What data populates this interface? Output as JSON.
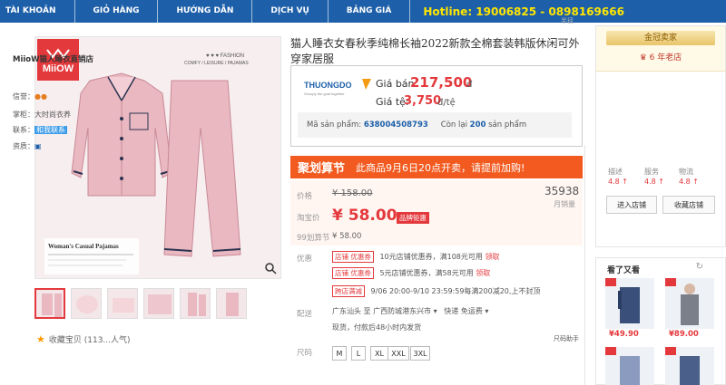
{
  "nav": {
    "items": [
      "TÀI KHOẢN",
      "GIỎ HÀNG",
      "HƯỚNG DẪN",
      "DỊCH VỤ",
      "BẢNG GIÁ"
    ],
    "hotline": "Hotline: 19006825 - 0898169666"
  },
  "gallery": {
    "brand_logo": "MiiOW",
    "fashion_text": "♥ ♥ ♥  FASHION",
    "fashion_sub": "COMFY / LEISURE / PAJAMAS",
    "caption": "Woman's Casual Pajamas",
    "thumb_count": 6
  },
  "favorite": {
    "label": "收藏宝贝 (113...人气)"
  },
  "product": {
    "title": "猫人睡衣女春秋季纯棉长袖2022新款全棉套装韩版休闲可外穿家居服",
    "logo": "THUONGDO",
    "logo_sub": "Occupy the goal together",
    "sale_label": "Giá bán:",
    "sale_price": "217,500",
    "sale_unit": "đ",
    "rate_label": "Giá tệ:",
    "rate_price": "3,750",
    "rate_unit": "đ/tệ",
    "code_label": "Mã sản phẩm:",
    "code": "638004508793",
    "stock_prefix": "Còn lại",
    "stock": "200",
    "stock_suffix": "sản phẩm"
  },
  "promo": {
    "logo": "聚划算节",
    "text": "此商品9月6日20点开卖，请提前加购!"
  },
  "detail": {
    "price_label": "价格",
    "old_price": "¥ 158.00",
    "taobao_label": "淘宝价",
    "new_price": "¥ 58.00",
    "badge": "品牌钜惠",
    "jhs_label": "99划算节",
    "jhs_price": "¥ 58.00",
    "sold": "35938",
    "sold_label": "月销量"
  },
  "offers": {
    "label": "优惠",
    "coupon1_tag": "店铺 优惠券",
    "coupon1_text": "10元店铺优惠券，满108元可用",
    "coupon1_link": "领取",
    "coupon2_tag": "店铺 优惠券",
    "coupon2_text": "5元店铺优惠券，满58元可用",
    "coupon2_link": "领取",
    "cross_tag": "跨店满减",
    "cross_text": "9/06 20:00-9/10 23:59:59每满200减20,上不封顶"
  },
  "shipping": {
    "label": "配送",
    "from": "广东汕头 至  广西防城港东兴市",
    "express": "快递 免运费",
    "note": "现货，付款后48小时内发货"
  },
  "size": {
    "label": "尺码",
    "assistant": "尺码助手",
    "options": [
      "M",
      "L",
      "XL",
      "XXL",
      "3XL"
    ]
  },
  "shop": {
    "gold": "金冠卖家",
    "years": "6 年老店",
    "name": "MiioW猫人睡衣直销店",
    "credit_label": "信誉：",
    "seller_label": "掌柜：",
    "seller": "大时尚衣养",
    "contact_label": "联系：",
    "contact": "和我联系",
    "qual_label": "资质：",
    "rate_heads": [
      "描述",
      "服务",
      "物流"
    ],
    "rate_vals": [
      "4.8 ↑",
      "4.8 ↑",
      "4.8 ↑"
    ],
    "enter_btn": "进入店铺",
    "fav_btn": "收藏店铺"
  },
  "also": {
    "title": "看了又看",
    "prices": [
      "¥49.90",
      "¥89.00"
    ]
  },
  "colors": {
    "nav": "#1d5fa8",
    "hotline": "#ffe600",
    "accent": "#e4393c",
    "promo": "#f25a1f",
    "pajama": "#e9b8c0"
  }
}
